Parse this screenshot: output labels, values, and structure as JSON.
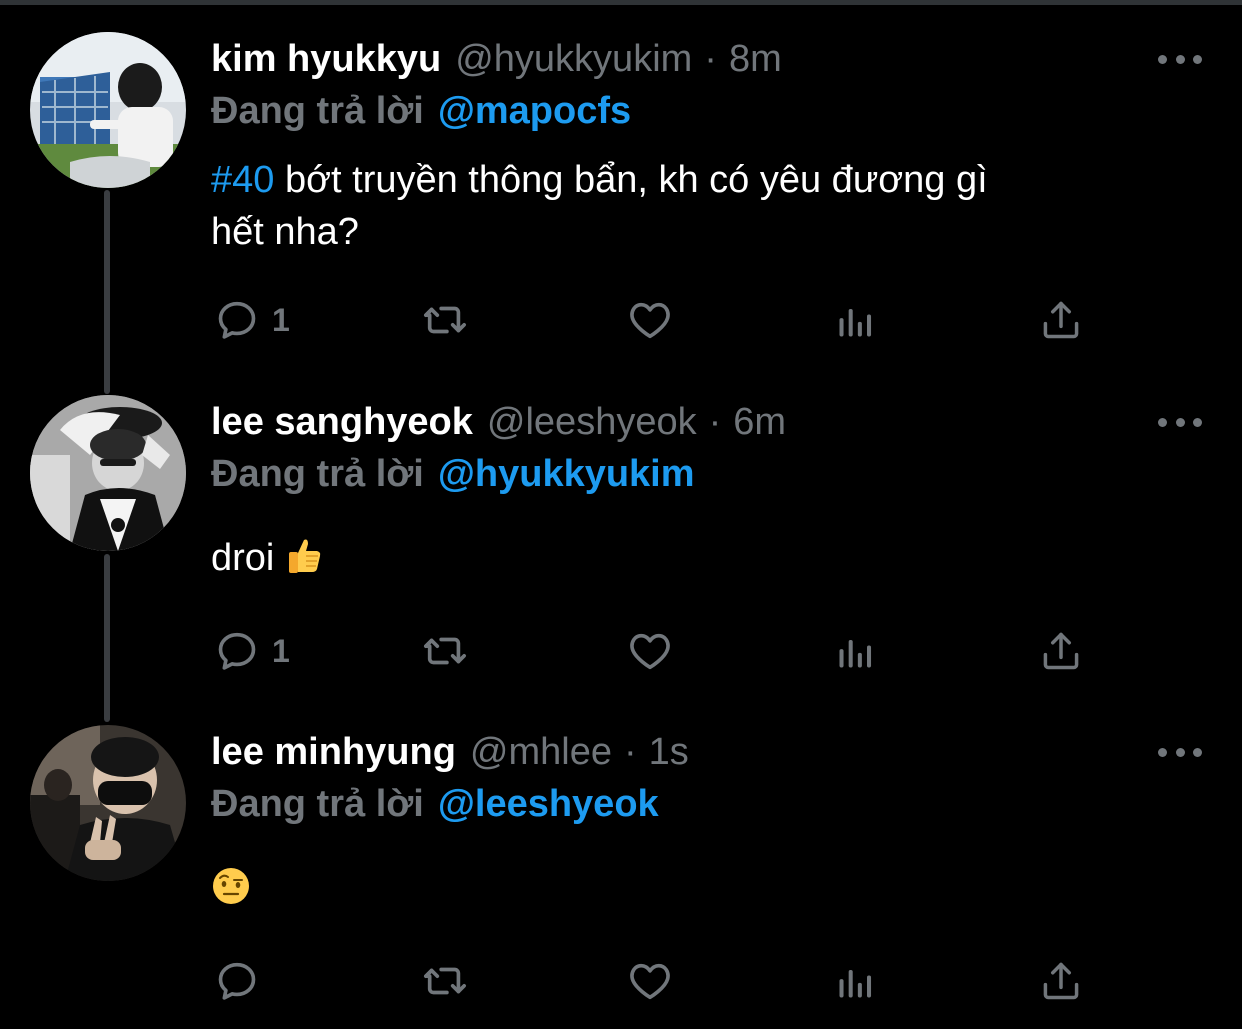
{
  "colors": {
    "background": "#000000",
    "text": "#ffffff",
    "muted": "#71767b",
    "link": "#1d9bf0",
    "thread_line": "#3a3d41"
  },
  "tweets": [
    {
      "display_name": "kim hyukkyu",
      "handle": "@hyukkyukim",
      "separator": "·",
      "time": "8m",
      "reply_prefix": "Đang trả lời",
      "reply_to": "@mapocfs",
      "hashtag": "#40",
      "text_line1": "bớt truyền thông bẩn, kh có yêu đương gì",
      "text_line2": "hết nha?",
      "reply_count": "1",
      "avatar_icon": "avatar-photo"
    },
    {
      "display_name": "lee sanghyeok",
      "handle": "@leeshyeok",
      "separator": "·",
      "time": "6m",
      "reply_prefix": "Đang trả lời",
      "reply_to": "@hyukkyukim",
      "text": "droi",
      "emoji": "thumbs-up",
      "reply_count": "1",
      "avatar_icon": "avatar-photo"
    },
    {
      "display_name": "lee minhyung",
      "handle": "@mhlee",
      "separator": "·",
      "time": "1s",
      "reply_prefix": "Đang trả lời",
      "reply_to": "@leeshyeok",
      "emoji": "face-with-raised-eyebrow",
      "reply_count": "",
      "avatar_icon": "avatar-photo"
    }
  ],
  "action_icons": [
    "reply-icon",
    "retweet-icon",
    "like-icon",
    "analytics-icon",
    "share-icon"
  ]
}
